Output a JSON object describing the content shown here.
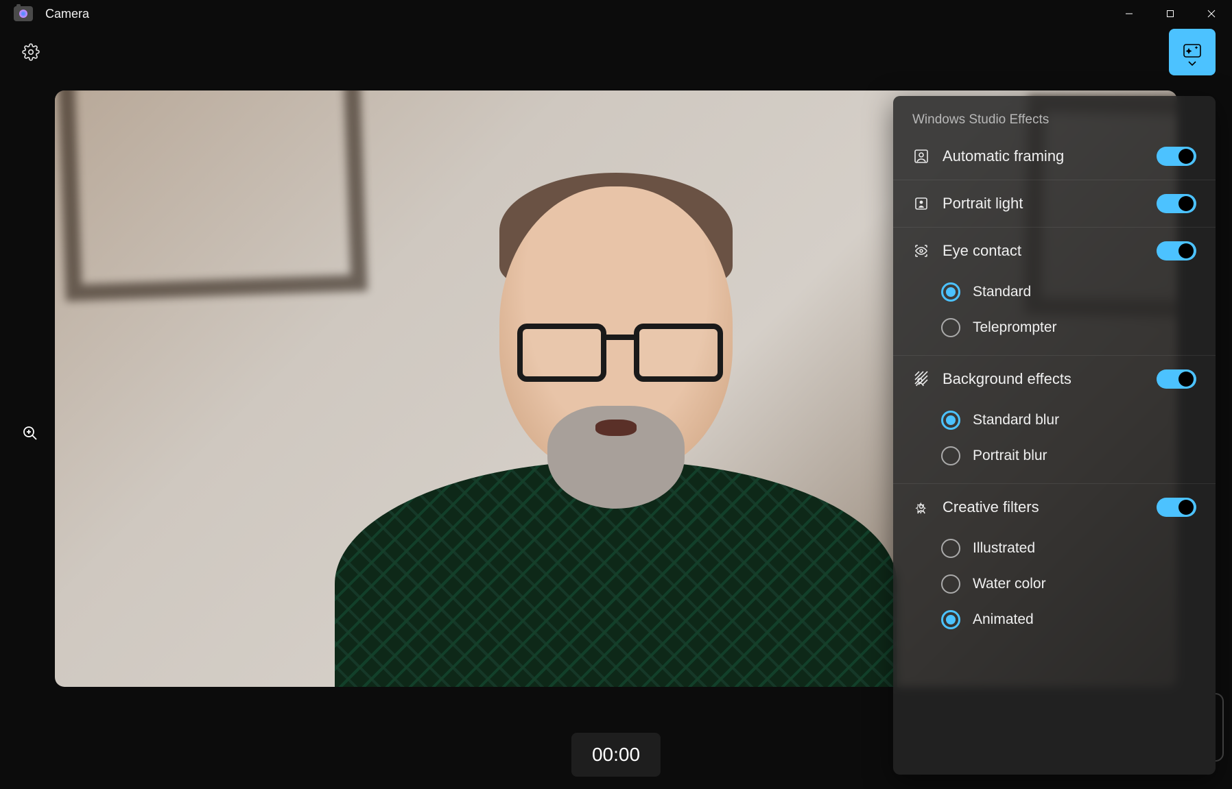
{
  "app": {
    "title": "Camera"
  },
  "timer": "00:00",
  "panel": {
    "title": "Windows Studio Effects",
    "autoFraming": {
      "label": "Automatic framing",
      "on": true
    },
    "portraitLight": {
      "label": "Portrait light",
      "on": true
    },
    "eyeContact": {
      "label": "Eye contact",
      "on": true,
      "options": [
        {
          "label": "Standard",
          "selected": true
        },
        {
          "label": "Teleprompter",
          "selected": false
        }
      ]
    },
    "backgroundEffects": {
      "label": "Background effects",
      "on": true,
      "options": [
        {
          "label": "Standard blur",
          "selected": true
        },
        {
          "label": "Portrait blur",
          "selected": false
        }
      ]
    },
    "creativeFilters": {
      "label": "Creative filters",
      "on": true,
      "options": [
        {
          "label": "Illustrated",
          "selected": false
        },
        {
          "label": "Water color",
          "selected": false
        },
        {
          "label": "Animated",
          "selected": true
        }
      ]
    }
  },
  "colors": {
    "accent": "#4cc2ff"
  }
}
